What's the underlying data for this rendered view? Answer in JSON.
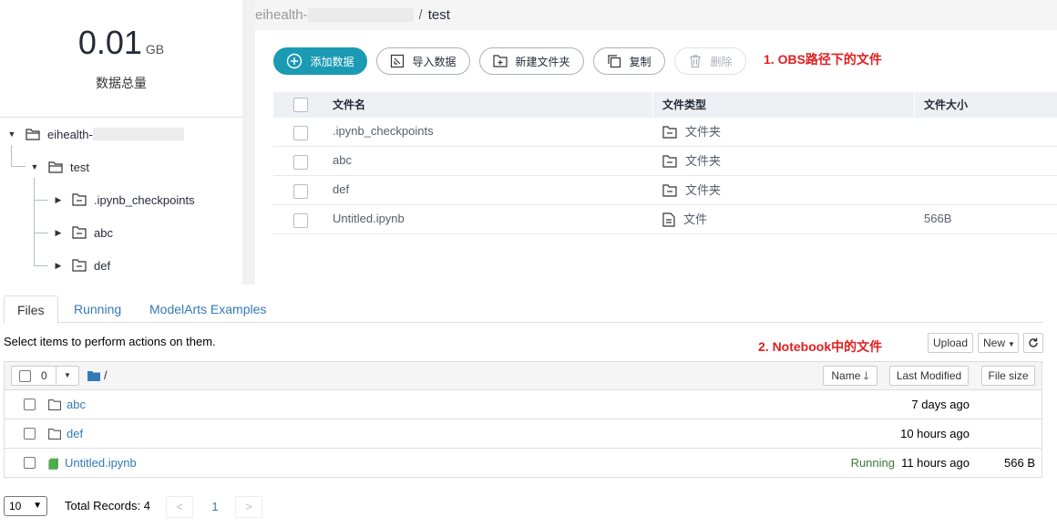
{
  "summary": {
    "amount": "0.01",
    "unit": "GB",
    "label": "数据总量"
  },
  "tree": {
    "root": "eihealth-",
    "child": "test",
    "items": [
      ".ipynb_checkpoints",
      "abc",
      "def"
    ]
  },
  "breadcrumb": {
    "root": "eihealth-",
    "separator": "/",
    "current": "test"
  },
  "toolbar": {
    "add": "添加数据",
    "import": "导入数据",
    "new_folder": "新建文件夹",
    "copy": "复制",
    "delete": "删除"
  },
  "annotations": {
    "obs": "1. OBS路径下的文件",
    "notebook": "2. Notebook中的文件"
  },
  "obs_table": {
    "headers": {
      "name": "文件名",
      "type": "文件类型",
      "size": "文件大小"
    },
    "rows": [
      {
        "name": ".ipynb_checkpoints",
        "type": "文件夹",
        "size": ""
      },
      {
        "name": "abc",
        "type": "文件夹",
        "size": ""
      },
      {
        "name": "def",
        "type": "文件夹",
        "size": ""
      },
      {
        "name": "Untitled.ipynb",
        "type": "文件",
        "size": "566B"
      }
    ]
  },
  "notebook": {
    "tabs": [
      "Files",
      "Running",
      "ModelArts Examples"
    ],
    "help": "Select items to perform actions on them.",
    "upload": "Upload",
    "new": "New",
    "selected_count": "0",
    "path": "/",
    "sort": {
      "name": "Name",
      "last_modified": "Last Modified",
      "file_size": "File size"
    },
    "rows": [
      {
        "name": "abc",
        "status": "",
        "modified": "7 days ago",
        "size": ""
      },
      {
        "name": "def",
        "status": "",
        "modified": "10 hours ago",
        "size": ""
      },
      {
        "name": "Untitled.ipynb",
        "status": "Running",
        "modified": "11 hours ago",
        "size": "566 B"
      }
    ]
  },
  "pagination": {
    "page_size": "10",
    "total": "Total Records: 4",
    "prev": "<",
    "page": "1",
    "next": ">"
  },
  "colors": {
    "primary": "#1b9ab3",
    "annotation": "#e02020",
    "link": "#337ab7",
    "running": "#3c763d"
  }
}
